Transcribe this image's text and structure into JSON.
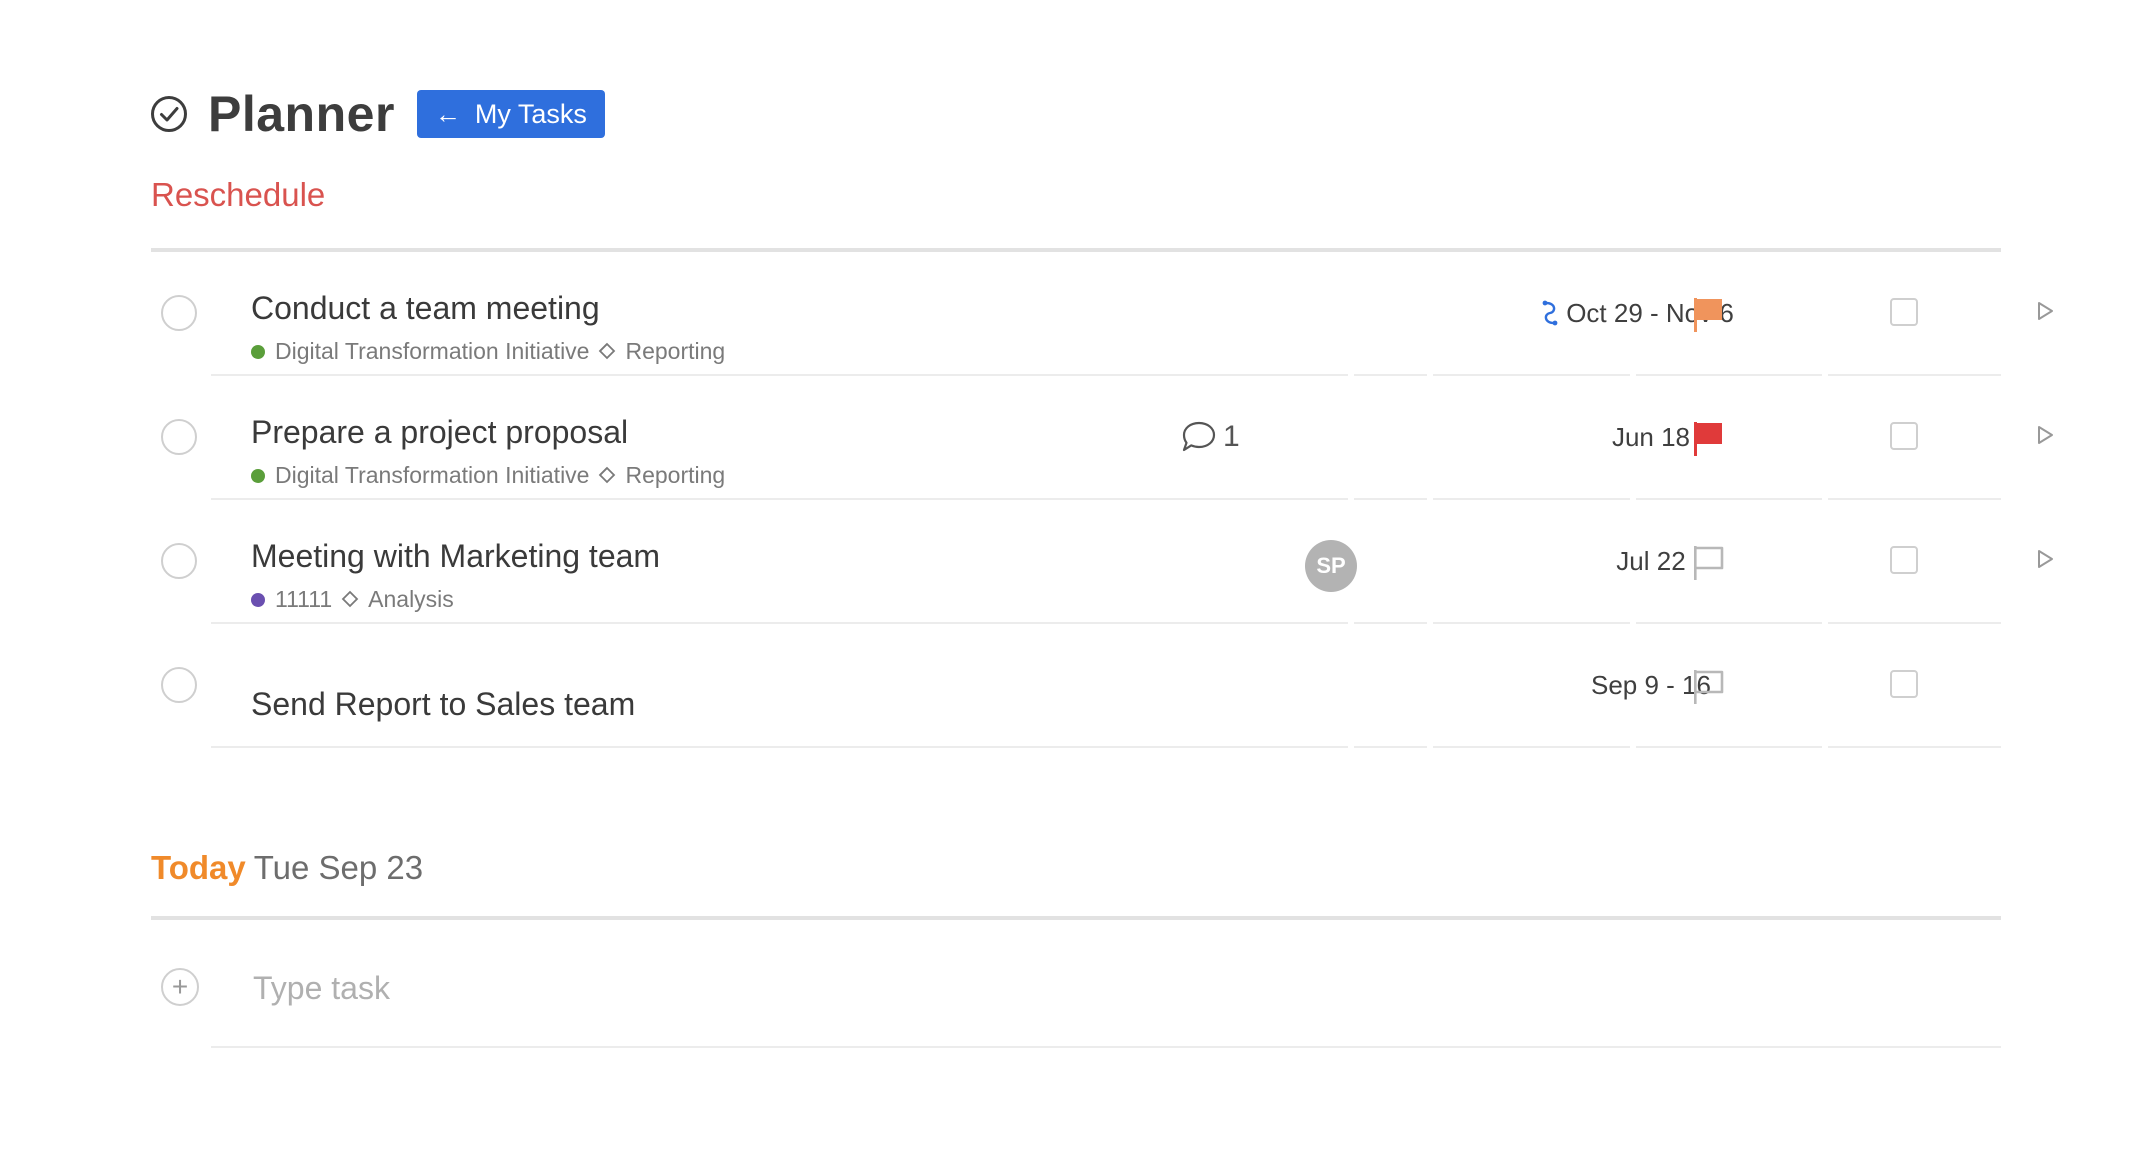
{
  "header": {
    "title": "Planner",
    "my_tasks_label": "My Tasks",
    "my_tasks_arrow": "←"
  },
  "sections": {
    "reschedule": {
      "title": "Reschedule"
    },
    "today": {
      "label": "Today",
      "date": "Tue Sep 23"
    }
  },
  "tasks": [
    {
      "name": "Conduct a team meeting",
      "project": "Digital Transformation Initiative",
      "project_color": "#5a9e3a",
      "tag": "Reporting",
      "date": "Oct 29 - Nov 6",
      "recurring": true,
      "flag": "orange",
      "comments": null,
      "assignee": null
    },
    {
      "name": "Prepare a project proposal",
      "project": "Digital Transformation Initiative",
      "project_color": "#5a9e3a",
      "tag": "Reporting",
      "date": "Jun 18",
      "recurring": false,
      "flag": "red",
      "comments": "1",
      "assignee": null
    },
    {
      "name": "Meeting with Marketing team",
      "project": "11111",
      "project_color": "#6a4fb0",
      "tag": "Analysis",
      "date": "Jul 22",
      "recurring": false,
      "flag": "none",
      "comments": null,
      "assignee": "SP"
    },
    {
      "name": "Send Report to Sales team",
      "project": null,
      "tag": null,
      "date": "Sep 9 - 16",
      "recurring": false,
      "flag": "none",
      "comments": null,
      "assignee": null
    }
  ],
  "add_task": {
    "placeholder": "Type task",
    "plus": "+"
  },
  "colors": {
    "accent_blue": "#2f6fdd",
    "reschedule_red": "#d9534f",
    "today_orange": "#f08a2a",
    "flag_orange": "#f0945c",
    "flag_red": "#e03a3a",
    "flag_none": "#b8b8b8"
  }
}
